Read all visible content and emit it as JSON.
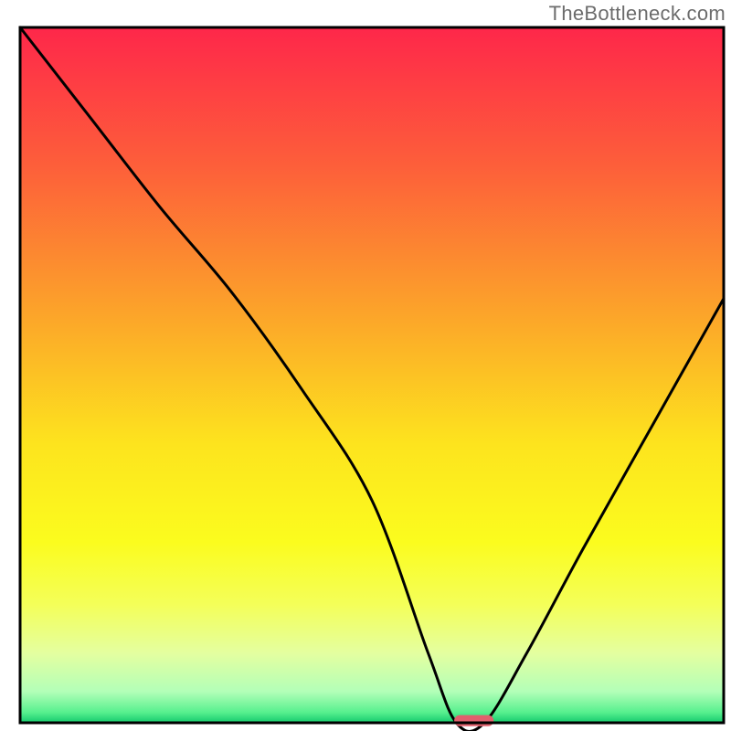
{
  "watermark": "TheBottleneck.com",
  "chart_data": {
    "type": "line",
    "title": "",
    "xlabel": "",
    "ylabel": "",
    "xlim": [
      0,
      100
    ],
    "ylim": [
      0,
      100
    ],
    "x": [
      0,
      10,
      20,
      30,
      40,
      50,
      58,
      62,
      66,
      72,
      80,
      90,
      100
    ],
    "values": [
      100,
      87,
      74,
      62,
      48,
      32,
      10,
      0,
      0,
      10,
      25,
      43,
      61
    ],
    "marker": {
      "x": 64.5,
      "y": 0.3,
      "width": 5.6,
      "height": 1.6,
      "color": "#e0606d"
    },
    "gradient_stops": [
      {
        "offset": 0.0,
        "color": "#fe274a"
      },
      {
        "offset": 0.2,
        "color": "#fd5f3a"
      },
      {
        "offset": 0.42,
        "color": "#fca729"
      },
      {
        "offset": 0.6,
        "color": "#fde41e"
      },
      {
        "offset": 0.74,
        "color": "#fbfc1e"
      },
      {
        "offset": 0.83,
        "color": "#f4ff59"
      },
      {
        "offset": 0.9,
        "color": "#e4ffa0"
      },
      {
        "offset": 0.955,
        "color": "#b3ffb8"
      },
      {
        "offset": 0.985,
        "color": "#57f08e"
      },
      {
        "offset": 1.0,
        "color": "#14c96d"
      }
    ],
    "border_color": "#000000",
    "curve_color": "#000000"
  }
}
